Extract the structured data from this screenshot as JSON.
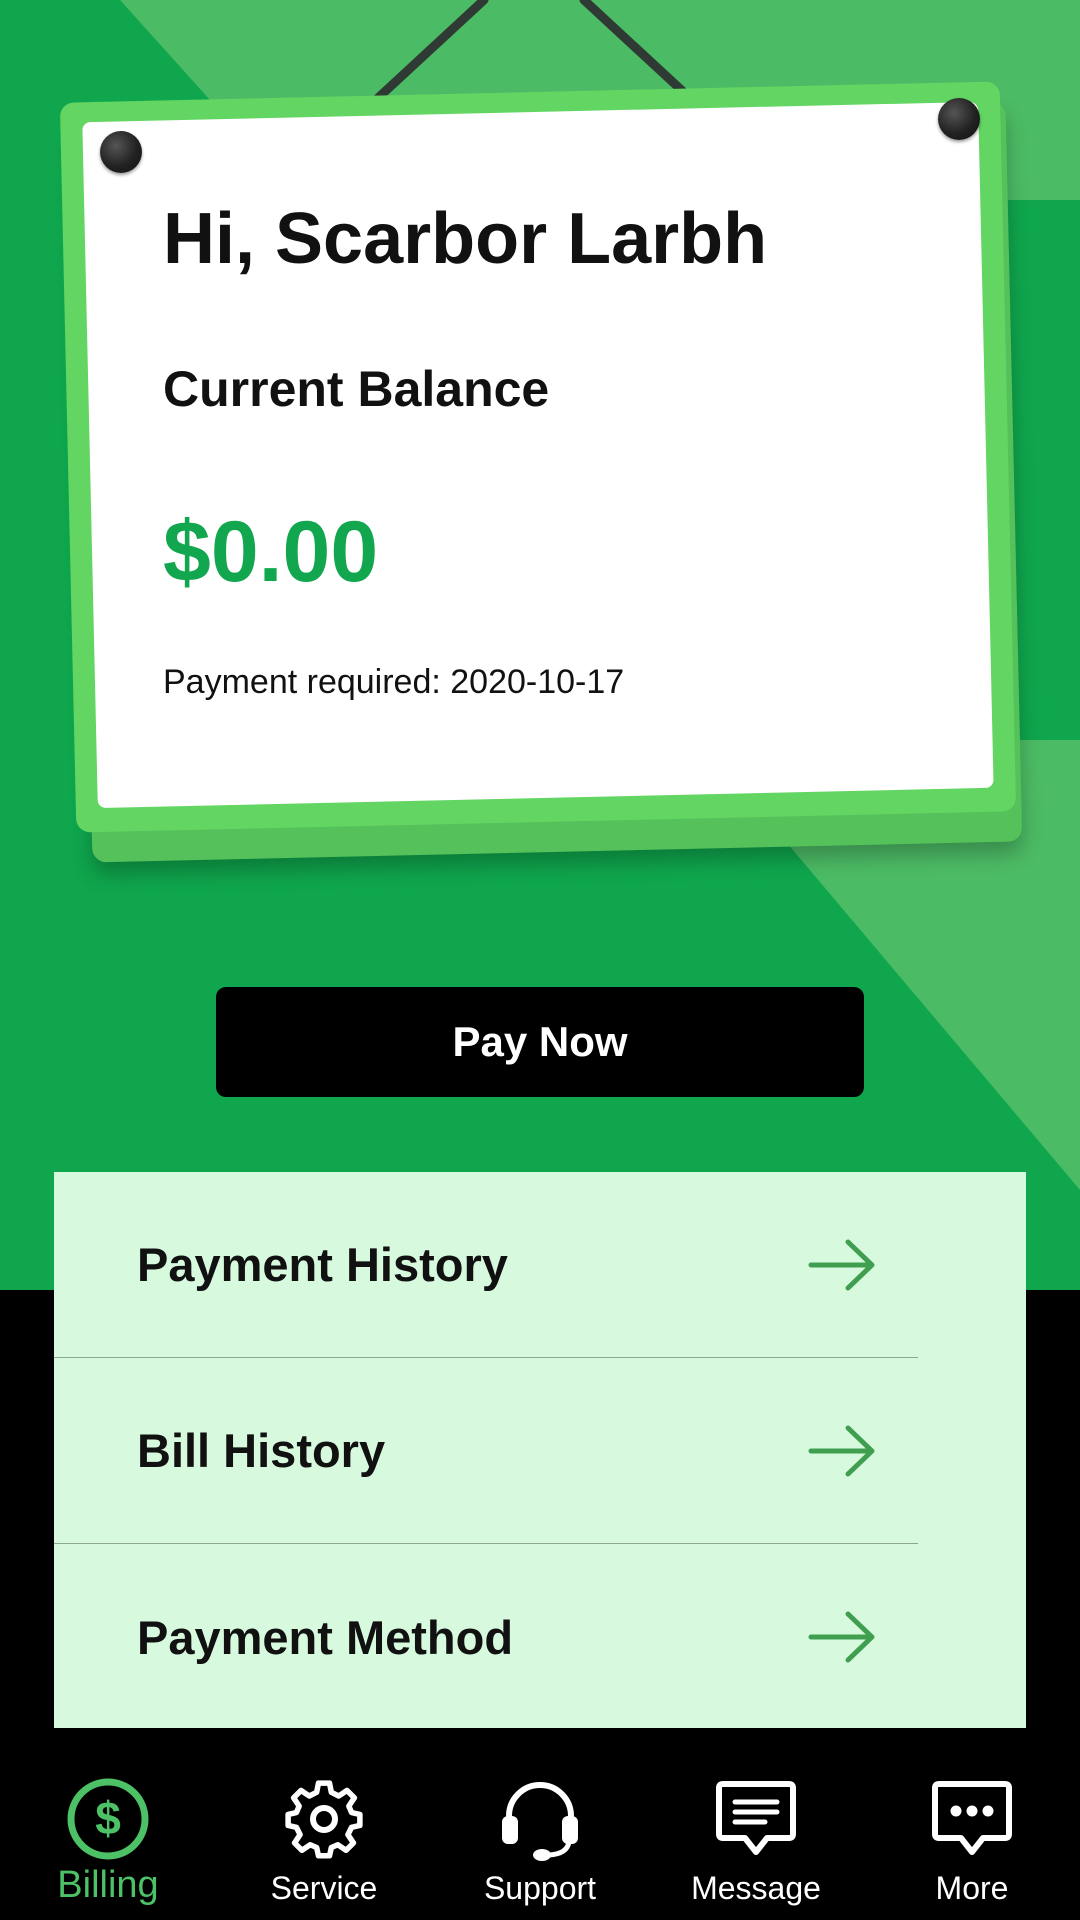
{
  "card": {
    "greeting": "Hi, Scarbor Larbh",
    "balance_label": "Current Balance",
    "balance_amount": "$0.00",
    "payment_required": "Payment required: 2020-10-17"
  },
  "actions": {
    "pay_now": "Pay Now"
  },
  "menu": {
    "items": [
      {
        "label": "Payment History",
        "icon": "arrow-right-icon"
      },
      {
        "label": "Bill History",
        "icon": "arrow-right-icon"
      },
      {
        "label": "Payment Method",
        "icon": "arrow-right-icon"
      }
    ]
  },
  "nav": {
    "items": [
      {
        "label": "Billing",
        "icon": "dollar-circle-icon",
        "active": true
      },
      {
        "label": "Service",
        "icon": "gear-icon",
        "active": false
      },
      {
        "label": "Support",
        "icon": "headset-icon",
        "active": false
      },
      {
        "label": "Message",
        "icon": "message-icon",
        "active": false
      },
      {
        "label": "More",
        "icon": "more-chat-icon",
        "active": false
      }
    ]
  },
  "colors": {
    "brand_green": "#0fa64d",
    "light_green": "#4cbb65",
    "balance_green": "#12a64e",
    "menu_bg": "#d7fadf",
    "active_nav": "#4cc165",
    "arrow_green": "#3f9e4f"
  }
}
